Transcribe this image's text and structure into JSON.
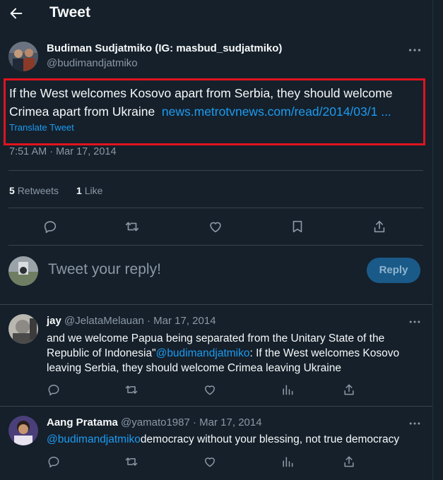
{
  "header": {
    "title": "Tweet"
  },
  "tweet": {
    "author_name": "Budiman Sudjatmiko (IG: masbud_sudjatmiko)",
    "author_handle": "@budimandjatmiko",
    "text": "If the West welcomes Kosovo apart from Serbia, they should welcome Crimea apart from Ukraine",
    "link_text": "news.metrotvnews.com/read/2014/03/1 ...",
    "translate_label": "Translate Tweet",
    "timestamp": "7:51 AM · Mar 17, 2014",
    "retweet_count": "5",
    "retweet_label": "Retweets",
    "like_count": "1",
    "like_label": "Like",
    "highlight_color": "#e0141e"
  },
  "composer": {
    "placeholder": "Tweet your reply!",
    "reply_button": "Reply"
  },
  "replies": [
    {
      "name": "jay",
      "handle": "@JelataMelauan",
      "date": "· Mar 17, 2014",
      "text_before": "and we welcome Papua being separated from the Unitary State of the Republic of Indonesia\"",
      "mention": "@budimandjatmiko",
      "text_after": ": If the West welcomes Kosovo leaving Serbia, they should welcome Crimea leaving Ukraine"
    },
    {
      "name": "Aang Pratama",
      "handle": "@yamato1987",
      "date": "· Mar 17, 2014",
      "mention": "@budimandjatmiko",
      "text_after": "democracy without your blessing, not true democracy"
    }
  ],
  "colors": {
    "background": "#15202b",
    "accent": "#1d9bf0",
    "muted": "#8b98a5",
    "divider": "#38444d"
  },
  "icons": [
    "back-arrow-icon",
    "more-icon",
    "reply-icon",
    "retweet-icon",
    "like-icon",
    "bookmark-icon",
    "share-icon",
    "views-icon"
  ]
}
